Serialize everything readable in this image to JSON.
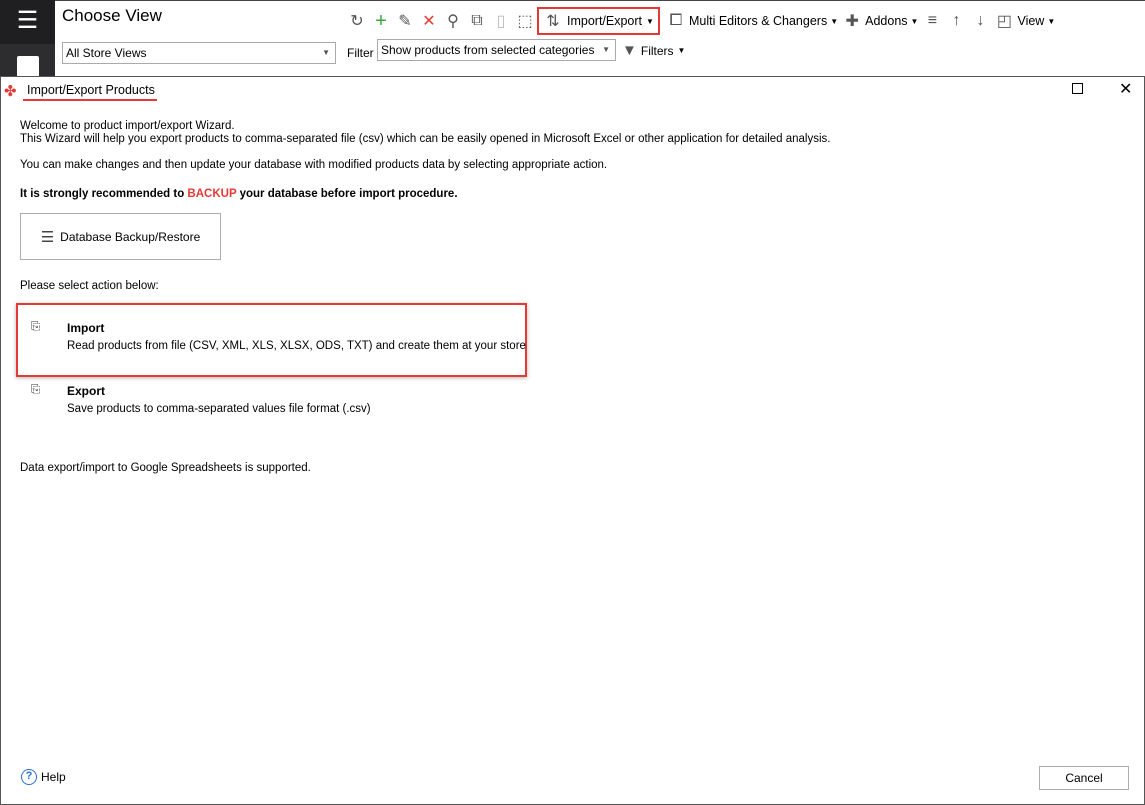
{
  "app": {
    "choose_view": "Choose View",
    "store_view": "All Store Views",
    "filter_label": "Filter",
    "filter_value": "Show products from selected categories",
    "filters_button": "Filters",
    "toolbar": {
      "import_export": "Import/Export",
      "multi_editors": "Multi Editors & Changers",
      "addons": "Addons",
      "view": "View"
    },
    "accent": "#e53935"
  },
  "dialog": {
    "title": "Import/Export Products",
    "welcome": "Welcome to product import/export Wizard.",
    "desc": "This Wizard will help you export products to comma-separated file (csv) which can be easily opened in Microsoft Excel or other application for detailed analysis.",
    "changes": "You can make changes and then update your database with modified products data by selecting appropriate action.",
    "warn_pre": "It is strongly recommended to ",
    "warn_backup": "BACKUP",
    "warn_post": " your database before import procedure.",
    "backup_button": "Database Backup/Restore",
    "select_action": "Please select action below:",
    "import_title": "Import",
    "import_desc": "Read products from file (CSV, XML, XLS, XLSX, ODS, TXT) and create them at your store",
    "export_title": "Export",
    "export_desc": "Save products to comma-separated values file format (.csv)",
    "google": "Data export/import to Google Spreadsheets is supported.",
    "help": "Help",
    "cancel": "Cancel"
  }
}
